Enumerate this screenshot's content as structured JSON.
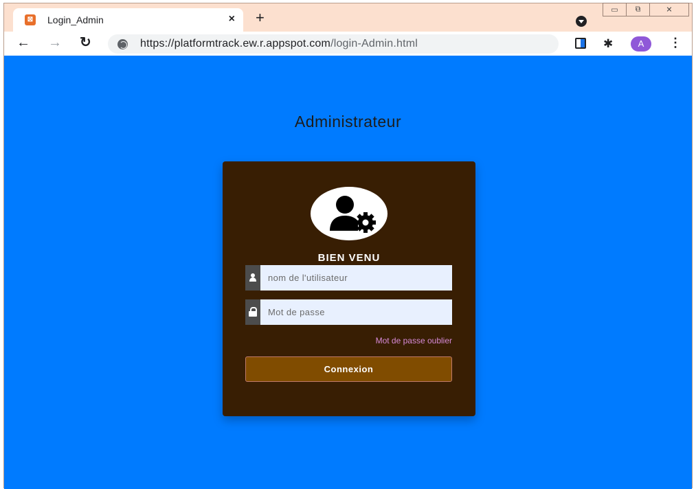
{
  "browser": {
    "tab_title": "Login_Admin",
    "tab_favicon_text": "⊠",
    "close_tab": "×",
    "new_tab": "+",
    "url_host": "https://platformtrack.ew.r.appspot.com",
    "url_path": "/login-Admin.html",
    "avatar_letter": "A",
    "back": "←",
    "forward": "→",
    "reload": "↻",
    "menu": "⋮",
    "puzzle": "✱",
    "win_minimize": "▭",
    "win_restore": "⧉",
    "win_close": "✕"
  },
  "page": {
    "title": "Administrateur",
    "welcome": "BIEN VENU",
    "username_placeholder": "nom de l'utilisateur",
    "password_placeholder": "Mot de passe",
    "forgot_password": "Mot de passe oublier",
    "login_button": "Connexion"
  },
  "colors": {
    "page_background": "#007bff",
    "card_background": "#381e03",
    "button_background": "#804c00",
    "link_color": "#d68ad8",
    "input_background": "#e8f0fe",
    "browser_frame": "#fce0cf"
  },
  "icons": {
    "avatar_icon": "admin-user-gear-icon",
    "username_icon": "user-icon",
    "password_icon": "lock-icon"
  }
}
